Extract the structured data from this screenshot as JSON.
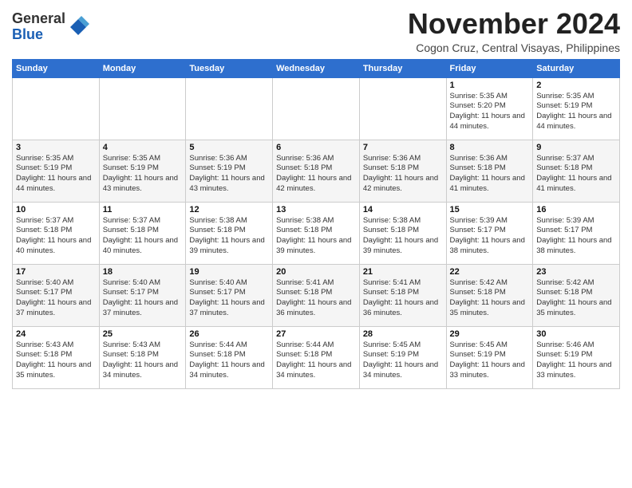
{
  "logo": {
    "general": "General",
    "blue": "Blue"
  },
  "header": {
    "month": "November 2024",
    "location": "Cogon Cruz, Central Visayas, Philippines"
  },
  "weekdays": [
    "Sunday",
    "Monday",
    "Tuesday",
    "Wednesday",
    "Thursday",
    "Friday",
    "Saturday"
  ],
  "weeks": [
    [
      {
        "day": "",
        "info": ""
      },
      {
        "day": "",
        "info": ""
      },
      {
        "day": "",
        "info": ""
      },
      {
        "day": "",
        "info": ""
      },
      {
        "day": "",
        "info": ""
      },
      {
        "day": "1",
        "info": "Sunrise: 5:35 AM\nSunset: 5:20 PM\nDaylight: 11 hours and 44 minutes."
      },
      {
        "day": "2",
        "info": "Sunrise: 5:35 AM\nSunset: 5:19 PM\nDaylight: 11 hours and 44 minutes."
      }
    ],
    [
      {
        "day": "3",
        "info": "Sunrise: 5:35 AM\nSunset: 5:19 PM\nDaylight: 11 hours and 44 minutes."
      },
      {
        "day": "4",
        "info": "Sunrise: 5:35 AM\nSunset: 5:19 PM\nDaylight: 11 hours and 43 minutes."
      },
      {
        "day": "5",
        "info": "Sunrise: 5:36 AM\nSunset: 5:19 PM\nDaylight: 11 hours and 43 minutes."
      },
      {
        "day": "6",
        "info": "Sunrise: 5:36 AM\nSunset: 5:18 PM\nDaylight: 11 hours and 42 minutes."
      },
      {
        "day": "7",
        "info": "Sunrise: 5:36 AM\nSunset: 5:18 PM\nDaylight: 11 hours and 42 minutes."
      },
      {
        "day": "8",
        "info": "Sunrise: 5:36 AM\nSunset: 5:18 PM\nDaylight: 11 hours and 41 minutes."
      },
      {
        "day": "9",
        "info": "Sunrise: 5:37 AM\nSunset: 5:18 PM\nDaylight: 11 hours and 41 minutes."
      }
    ],
    [
      {
        "day": "10",
        "info": "Sunrise: 5:37 AM\nSunset: 5:18 PM\nDaylight: 11 hours and 40 minutes."
      },
      {
        "day": "11",
        "info": "Sunrise: 5:37 AM\nSunset: 5:18 PM\nDaylight: 11 hours and 40 minutes."
      },
      {
        "day": "12",
        "info": "Sunrise: 5:38 AM\nSunset: 5:18 PM\nDaylight: 11 hours and 39 minutes."
      },
      {
        "day": "13",
        "info": "Sunrise: 5:38 AM\nSunset: 5:18 PM\nDaylight: 11 hours and 39 minutes."
      },
      {
        "day": "14",
        "info": "Sunrise: 5:38 AM\nSunset: 5:18 PM\nDaylight: 11 hours and 39 minutes."
      },
      {
        "day": "15",
        "info": "Sunrise: 5:39 AM\nSunset: 5:17 PM\nDaylight: 11 hours and 38 minutes."
      },
      {
        "day": "16",
        "info": "Sunrise: 5:39 AM\nSunset: 5:17 PM\nDaylight: 11 hours and 38 minutes."
      }
    ],
    [
      {
        "day": "17",
        "info": "Sunrise: 5:40 AM\nSunset: 5:17 PM\nDaylight: 11 hours and 37 minutes."
      },
      {
        "day": "18",
        "info": "Sunrise: 5:40 AM\nSunset: 5:17 PM\nDaylight: 11 hours and 37 minutes."
      },
      {
        "day": "19",
        "info": "Sunrise: 5:40 AM\nSunset: 5:17 PM\nDaylight: 11 hours and 37 minutes."
      },
      {
        "day": "20",
        "info": "Sunrise: 5:41 AM\nSunset: 5:18 PM\nDaylight: 11 hours and 36 minutes."
      },
      {
        "day": "21",
        "info": "Sunrise: 5:41 AM\nSunset: 5:18 PM\nDaylight: 11 hours and 36 minutes."
      },
      {
        "day": "22",
        "info": "Sunrise: 5:42 AM\nSunset: 5:18 PM\nDaylight: 11 hours and 35 minutes."
      },
      {
        "day": "23",
        "info": "Sunrise: 5:42 AM\nSunset: 5:18 PM\nDaylight: 11 hours and 35 minutes."
      }
    ],
    [
      {
        "day": "24",
        "info": "Sunrise: 5:43 AM\nSunset: 5:18 PM\nDaylight: 11 hours and 35 minutes."
      },
      {
        "day": "25",
        "info": "Sunrise: 5:43 AM\nSunset: 5:18 PM\nDaylight: 11 hours and 34 minutes."
      },
      {
        "day": "26",
        "info": "Sunrise: 5:44 AM\nSunset: 5:18 PM\nDaylight: 11 hours and 34 minutes."
      },
      {
        "day": "27",
        "info": "Sunrise: 5:44 AM\nSunset: 5:18 PM\nDaylight: 11 hours and 34 minutes."
      },
      {
        "day": "28",
        "info": "Sunrise: 5:45 AM\nSunset: 5:19 PM\nDaylight: 11 hours and 34 minutes."
      },
      {
        "day": "29",
        "info": "Sunrise: 5:45 AM\nSunset: 5:19 PM\nDaylight: 11 hours and 33 minutes."
      },
      {
        "day": "30",
        "info": "Sunrise: 5:46 AM\nSunset: 5:19 PM\nDaylight: 11 hours and 33 minutes."
      }
    ]
  ]
}
